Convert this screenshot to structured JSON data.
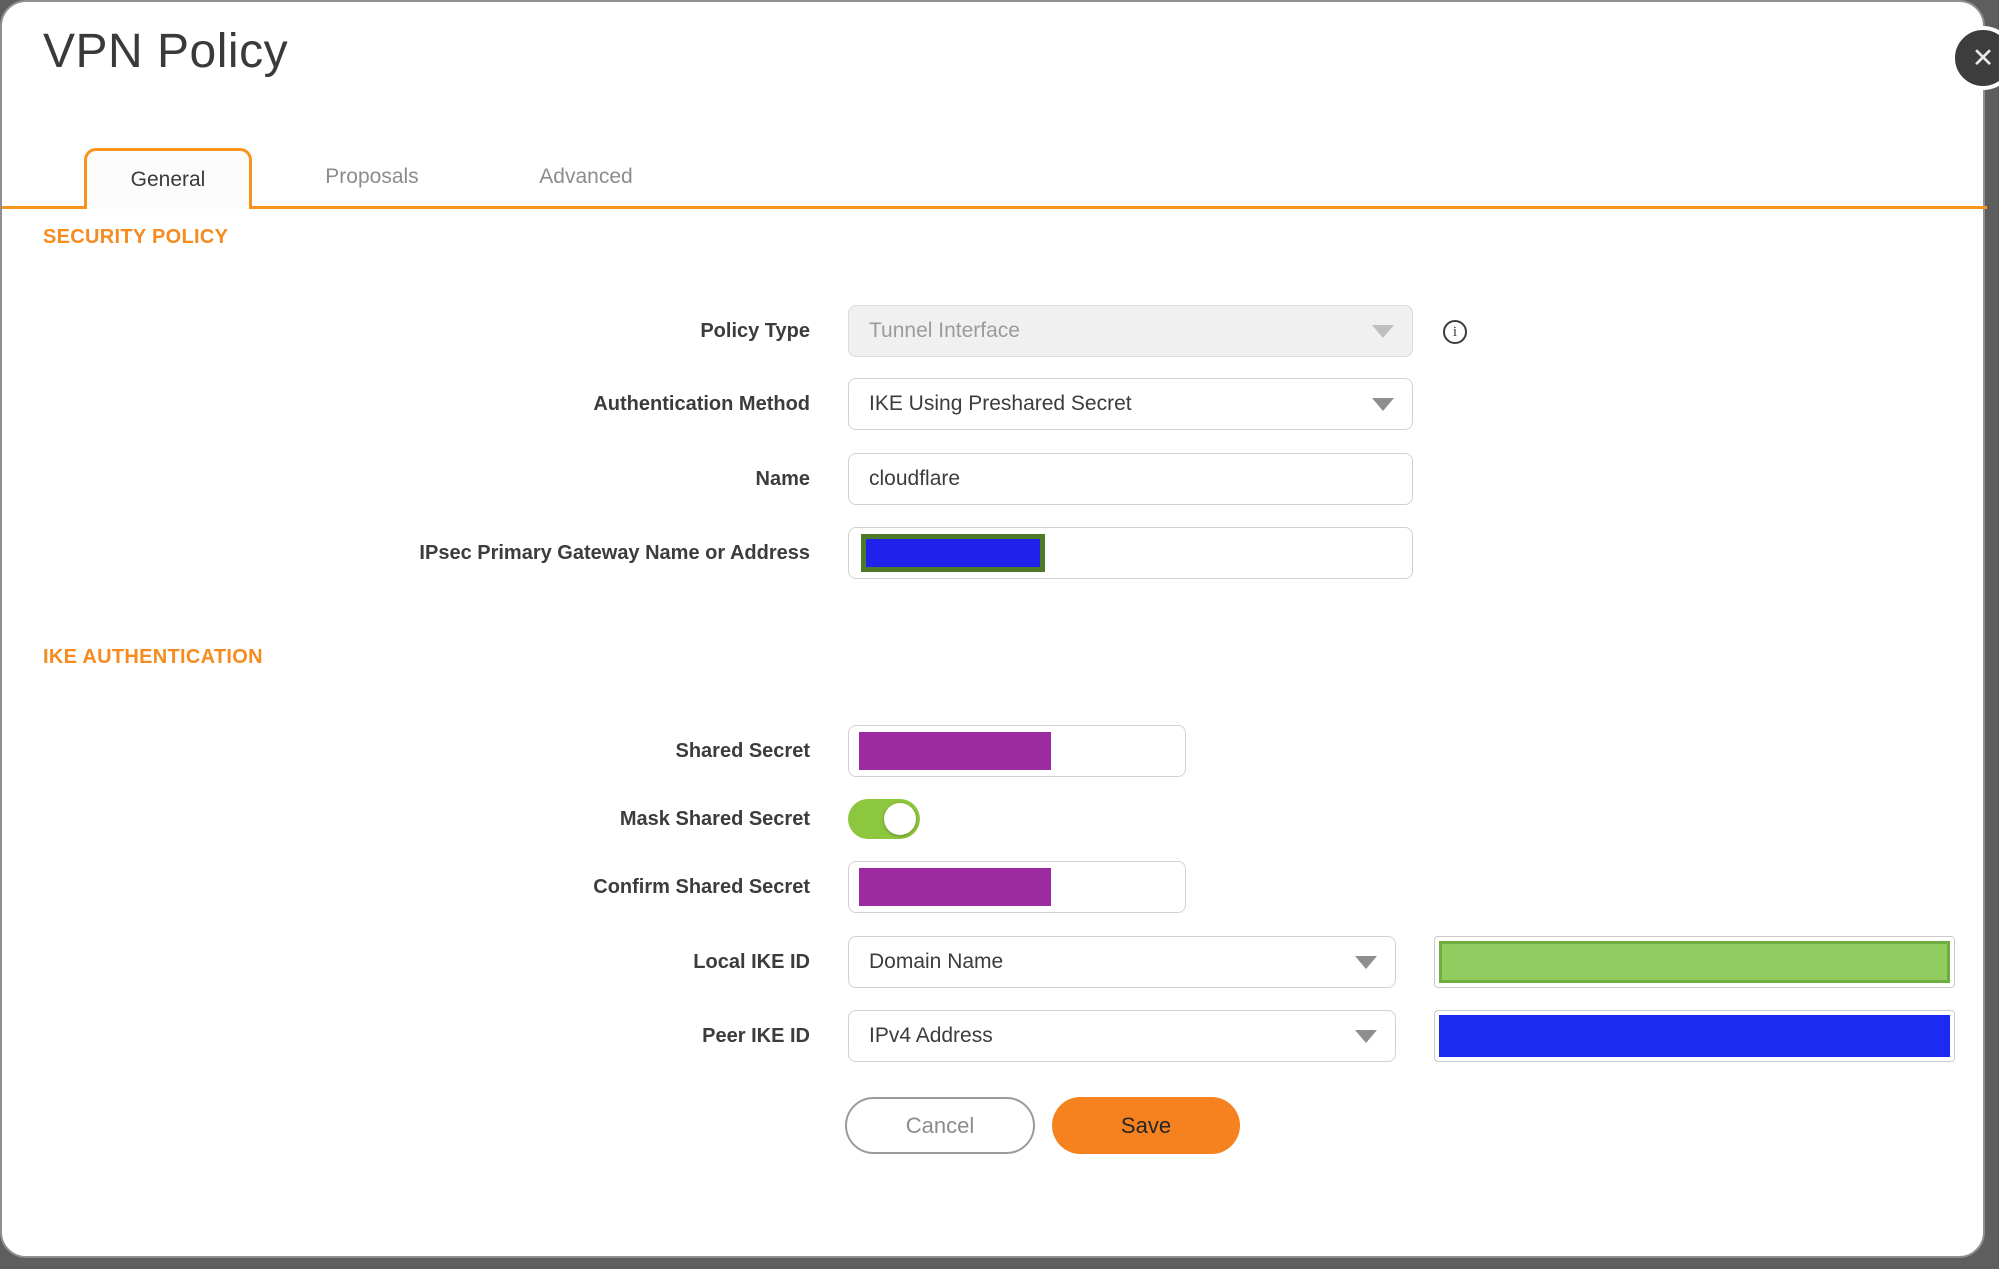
{
  "dialog": {
    "title": "VPN Policy"
  },
  "icons": {
    "close": "✕",
    "info": "i"
  },
  "tabs": [
    {
      "label": "General",
      "active": true
    },
    {
      "label": "Proposals",
      "active": false
    },
    {
      "label": "Advanced",
      "active": false
    }
  ],
  "sections": {
    "security_policy": "SECURITY POLICY",
    "ike_authentication": "IKE AUTHENTICATION"
  },
  "fields": {
    "policy_type": {
      "label": "Policy Type",
      "value": "Tunnel Interface",
      "disabled": true
    },
    "authentication_method": {
      "label": "Authentication Method",
      "value": "IKE Using Preshared Secret"
    },
    "name": {
      "label": "Name",
      "value": "cloudflare"
    },
    "ipsec_primary_gateway": {
      "label": "IPsec Primary Gateway Name or Address",
      "value_redacted": true,
      "redaction_fill": "#2222EE",
      "redaction_border": "#4E7A28"
    },
    "shared_secret": {
      "label": "Shared Secret",
      "value_redacted": true,
      "redaction_fill": "#9C2AA0"
    },
    "mask_shared_secret": {
      "label": "Mask Shared Secret",
      "enabled": true
    },
    "confirm_shared_secret": {
      "label": "Confirm Shared Secret",
      "value_redacted": true,
      "redaction_fill": "#9C2AA0"
    },
    "local_ike_id": {
      "label": "Local IKE ID",
      "type_value": "Domain Name",
      "value_redacted": true,
      "redaction_fill": "#92CB5F",
      "redaction_border": "#6FAE3E"
    },
    "peer_ike_id": {
      "label": "Peer IKE ID",
      "type_value": "IPv4 Address",
      "value_redacted": true,
      "redaction_fill": "#1B2BF2"
    }
  },
  "buttons": {
    "cancel": "Cancel",
    "save": "Save"
  },
  "colors": {
    "accent_orange": "#F68B1F",
    "tab_border_orange": "#F7941D",
    "toggle_green": "#8DC63F",
    "backdrop_gray": "#5E5E5E",
    "save_orange": "#F6821F"
  }
}
